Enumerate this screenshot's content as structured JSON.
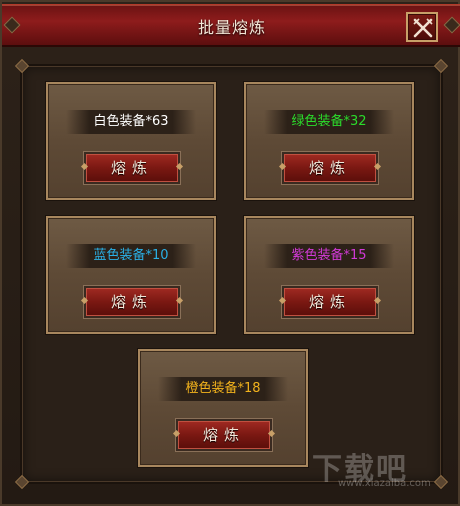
{
  "window": {
    "title": "批量熔炼",
    "close_icon": "crossed-swords-close-icon"
  },
  "cards": [
    {
      "id": "white",
      "label": "白色装备*63",
      "color": "#ffffff",
      "button": "熔炼"
    },
    {
      "id": "green",
      "label": "绿色装备*32",
      "color": "#2bdc2b",
      "button": "熔炼"
    },
    {
      "id": "blue",
      "label": "蓝色装备*10",
      "color": "#2ab0e6",
      "button": "熔炼"
    },
    {
      "id": "purple",
      "label": "紫色装备*15",
      "color": "#d23ad8",
      "button": "熔炼"
    },
    {
      "id": "orange",
      "label": "橙色装备*18",
      "color": "#f2b21c",
      "button": "熔炼"
    }
  ],
  "watermark": {
    "text": "下载吧",
    "url": "www.xiazaiba.com"
  }
}
